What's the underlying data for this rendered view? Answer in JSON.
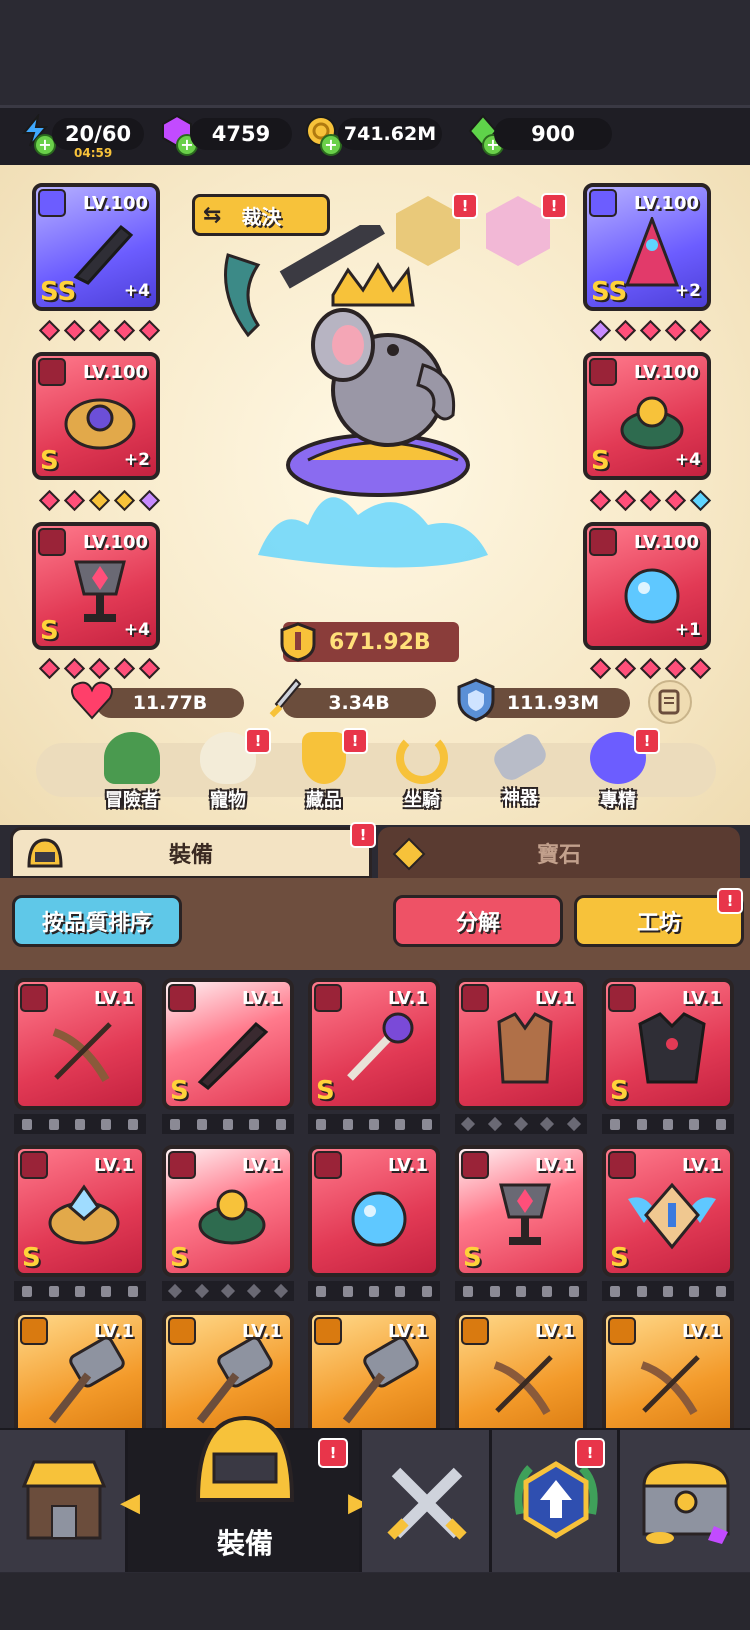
{
  "resources": {
    "energy": "20/60",
    "timer": "04:59",
    "gems": "4759",
    "gold": "741.62M",
    "emerald": "900"
  },
  "header": {
    "title_button": "裁決"
  },
  "equipment_left": [
    {
      "lv": "LV.100",
      "rank": "SS",
      "plus": "+4",
      "type_icon": "sword-icon",
      "bg": "purple"
    },
    {
      "lv": "LV.100",
      "rank": "S",
      "plus": "+2",
      "type_icon": "ring-icon",
      "bg": "red"
    },
    {
      "lv": "LV.100",
      "rank": "S",
      "plus": "+4",
      "type_icon": "necklace-icon",
      "bg": "red"
    }
  ],
  "equipment_right": [
    {
      "lv": "LV.100",
      "rank": "SS",
      "plus": "+2",
      "type_icon": "armor-icon",
      "bg": "purple"
    },
    {
      "lv": "LV.100",
      "rank": "S",
      "plus": "+4",
      "type_icon": "ring-icon",
      "bg": "red"
    },
    {
      "lv": "LV.100",
      "rank": "",
      "plus": "+1",
      "type_icon": "necklace-icon",
      "bg": "red"
    }
  ],
  "power": "671.92B",
  "stats": {
    "hp": "11.77B",
    "attack": "3.34B",
    "defense": "111.93M"
  },
  "menu": [
    {
      "label": "冒險者",
      "icon": "turtle-hero-icon",
      "badge": ""
    },
    {
      "label": "寵物",
      "icon": "egg-pet-icon",
      "badge": "!"
    },
    {
      "label": "藏品",
      "icon": "trophy-collection-icon",
      "badge": "!"
    },
    {
      "label": "坐騎",
      "icon": "horseshoe-mount-icon",
      "badge": ""
    },
    {
      "label": "神器",
      "icon": "hammer-artifact-icon",
      "badge": ""
    },
    {
      "label": "專精",
      "icon": "crown-mastery-icon",
      "badge": "!"
    }
  ],
  "tabs": {
    "equipment": "裝備",
    "gems": "寶石"
  },
  "actions": {
    "sort": "按品質排序",
    "decompose": "分解",
    "workshop": "工坊"
  },
  "inventory": [
    [
      {
        "lv": "LV.1",
        "rank": "",
        "icon": "crossbow-icon",
        "locks": "lock"
      },
      {
        "lv": "LV.1",
        "rank": "S",
        "icon": "sword-icon",
        "locks": "lock"
      },
      {
        "lv": "LV.1",
        "rank": "S",
        "icon": "staff-icon",
        "locks": "lock"
      },
      {
        "lv": "LV.1",
        "rank": "",
        "icon": "vest-icon",
        "locks": "dot"
      },
      {
        "lv": "LV.1",
        "rank": "S",
        "icon": "dark-armor-icon",
        "locks": "lock"
      }
    ],
    [
      {
        "lv": "LV.1",
        "rank": "S",
        "icon": "crystal-ring-icon",
        "locks": "lock"
      },
      {
        "lv": "LV.1",
        "rank": "S",
        "icon": "amber-ring-icon",
        "locks": "dot"
      },
      {
        "lv": "LV.1",
        "rank": "",
        "icon": "blue-orb-icon",
        "locks": "lock"
      },
      {
        "lv": "LV.1",
        "rank": "S",
        "icon": "chalice-icon",
        "locks": "lock"
      },
      {
        "lv": "LV.1",
        "rank": "S",
        "icon": "winged-badge-icon",
        "locks": "lock"
      }
    ],
    [
      {
        "lv": "LV.1",
        "rank": "",
        "icon": "hammer-icon",
        "locks": ""
      },
      {
        "lv": "LV.1",
        "rank": "",
        "icon": "hammer-icon",
        "locks": ""
      },
      {
        "lv": "LV.1",
        "rank": "",
        "icon": "hammer-icon",
        "locks": ""
      },
      {
        "lv": "LV.1",
        "rank": "",
        "icon": "crossbow-icon",
        "locks": ""
      },
      {
        "lv": "LV.1",
        "rank": "",
        "icon": "crossbow-icon",
        "locks": ""
      }
    ]
  ],
  "bottom_nav": {
    "shop_icon": "shop-icon",
    "equipment_label": "裝備",
    "battle_icon": "crossed-swords-icon",
    "upgrade_icon": "upgrade-arrow-icon",
    "chest_icon": "treasure-chest-icon"
  },
  "colors": {
    "accent_red": "#e23a55",
    "accent_yellow": "#f7c23a",
    "accent_purple": "#6c5dff"
  }
}
